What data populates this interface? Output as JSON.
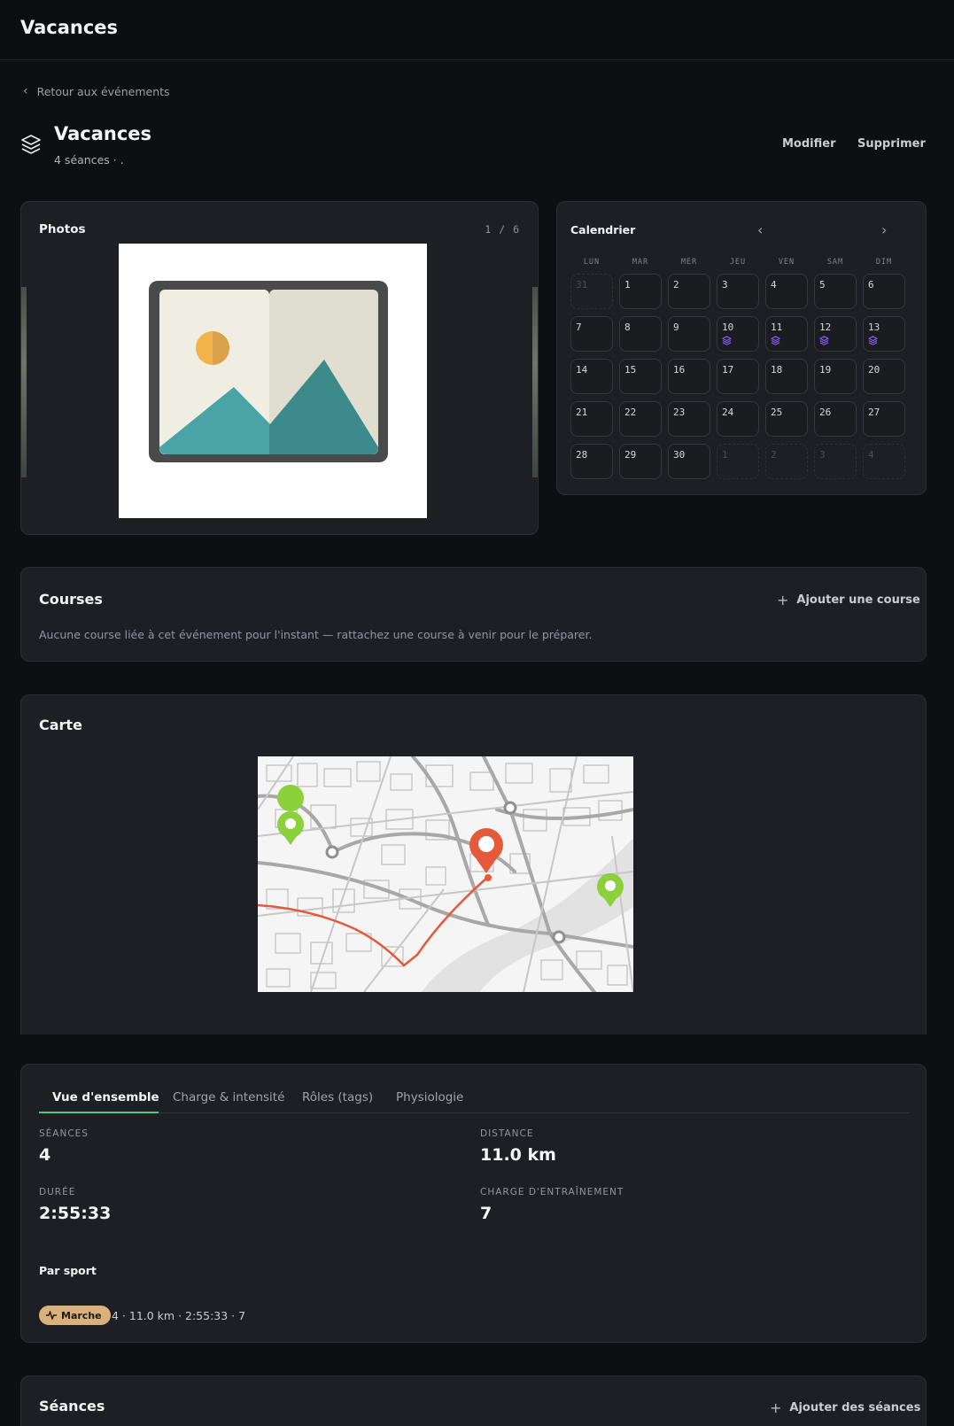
{
  "app": {
    "title": "Vacances"
  },
  "nav": {
    "back_label": "Retour aux événements"
  },
  "event": {
    "title": "Vacances",
    "subtitle": "4 séances · .",
    "edit_label": "Modifier",
    "delete_label": "Supprimer"
  },
  "photos": {
    "title": "Photos",
    "counter": "1 / 6"
  },
  "calendar": {
    "title": "Calendrier",
    "weekdays": [
      "LUN",
      "MAR",
      "MER",
      "JEU",
      "VEN",
      "SAM",
      "DIM"
    ],
    "weeks": [
      [
        {
          "d": "31",
          "other": true
        },
        {
          "d": "1"
        },
        {
          "d": "2"
        },
        {
          "d": "3"
        },
        {
          "d": "4"
        },
        {
          "d": "5"
        },
        {
          "d": "6"
        }
      ],
      [
        {
          "d": "7"
        },
        {
          "d": "8"
        },
        {
          "d": "9"
        },
        {
          "d": "10",
          "session": true
        },
        {
          "d": "11",
          "session": true
        },
        {
          "d": "12",
          "session": true
        },
        {
          "d": "13",
          "session": true
        }
      ],
      [
        {
          "d": "14"
        },
        {
          "d": "15"
        },
        {
          "d": "16"
        },
        {
          "d": "17"
        },
        {
          "d": "18"
        },
        {
          "d": "19"
        },
        {
          "d": "20"
        }
      ],
      [
        {
          "d": "21"
        },
        {
          "d": "22"
        },
        {
          "d": "23"
        },
        {
          "d": "24"
        },
        {
          "d": "25"
        },
        {
          "d": "26"
        },
        {
          "d": "27"
        }
      ],
      [
        {
          "d": "28"
        },
        {
          "d": "29"
        },
        {
          "d": "30"
        },
        {
          "d": "1",
          "other": true
        },
        {
          "d": "2",
          "other": true
        },
        {
          "d": "3",
          "other": true
        },
        {
          "d": "4",
          "other": true
        }
      ]
    ],
    "session_color": "#8b5cf6"
  },
  "courses": {
    "title": "Courses",
    "add_label": "Ajouter une course",
    "empty_text": "Aucune course liée à cet événement pour l'instant — rattachez une course à venir pour le préparer."
  },
  "map": {
    "title": "Carte"
  },
  "stats": {
    "tabs": [
      "Vue d'ensemble",
      "Charge & intensité",
      "Rôles (tags)",
      "Physiologie"
    ],
    "active_tab": 0,
    "items": [
      {
        "label": "SÉANCES",
        "value": "4"
      },
      {
        "label": "DISTANCE",
        "value": "11.0 km"
      },
      {
        "label": "DURÉE",
        "value": "2:55:33"
      },
      {
        "label": "CHARGE D'ENTRAÎNEMENT",
        "value": "7"
      }
    ],
    "by_sport_title": "Par sport",
    "sports": [
      {
        "name": "Marche",
        "summary": "4 · 11.0 km · 2:55:33 · 7",
        "color": "#d8b27a"
      }
    ]
  },
  "sessions": {
    "title": "Séances",
    "add_label": "Ajouter des séances"
  },
  "colors": {
    "accent": "#3ecf8e",
    "background": "#0d0f12",
    "card": "#1d1f24"
  }
}
